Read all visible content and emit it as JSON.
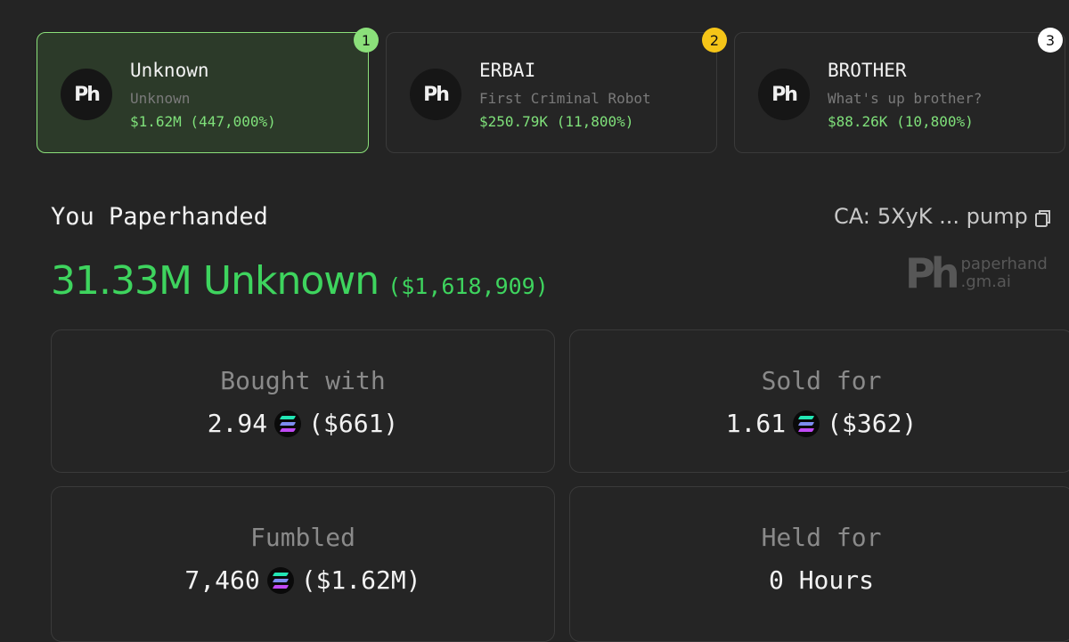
{
  "cards": [
    {
      "rank": "1",
      "title": "Unknown",
      "subtitle": "Unknown",
      "price": "$1.62M (447,000%)",
      "logo": "Ph",
      "badge_color": "#8be07a"
    },
    {
      "rank": "2",
      "title": "ERBAI",
      "subtitle": "First Criminal Robot",
      "price": "$250.79K (11,800%)",
      "logo": "Ph",
      "badge_color": "#f5c518"
    },
    {
      "rank": "3",
      "title": "BROTHER",
      "subtitle": "What's up brother?",
      "price": "$88.26K (10,800%)",
      "logo": "Ph",
      "badge_color": "#ffffff"
    }
  ],
  "heading": "You Paperhanded",
  "contract": {
    "label": "CA:",
    "value": "5XyK ... pump",
    "icon": "copy-icon"
  },
  "summary": {
    "amount": "31.33M Unknown",
    "usd": "($1,618,909)"
  },
  "brand": {
    "logo": "Ph",
    "line1": "paperhand",
    "line2": ".gm.ai"
  },
  "stats": {
    "bought": {
      "label": "Bought with",
      "amount": "2.94",
      "usd": "($661)",
      "icon": "solana-icon"
    },
    "sold": {
      "label": "Sold for",
      "amount": "1.61",
      "usd": "($362)",
      "icon": "solana-icon"
    },
    "fumbled": {
      "label": "Fumbled",
      "amount": "7,460",
      "usd": "($1.62M)",
      "icon": "solana-icon"
    },
    "held": {
      "label": "Held for",
      "value": "0 Hours"
    }
  },
  "colors": {
    "accent_green": "#3ed45e",
    "price_green": "#7fe07a",
    "background": "#242424"
  }
}
